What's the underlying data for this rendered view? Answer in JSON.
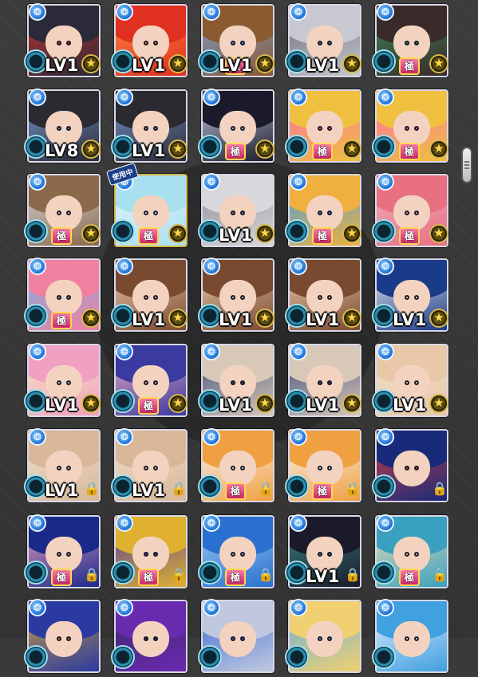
{
  "colors": {
    "element_water": "#1b6fd6",
    "frame_default": "#d8d8e8",
    "frame_gold": "#d9b24a",
    "star_gold": "#ffd84a"
  },
  "glyphs": {
    "star": "★",
    "lock": "🔒",
    "element": "❂"
  },
  "badges": {
    "goku": "極",
    "in_use": "使用中"
  },
  "rows": [
    [
      {
        "level": "LV1",
        "goku": false,
        "end": "star",
        "hair": "#2a2a38",
        "accent": "#c83030"
      },
      {
        "level": "LV1",
        "goku": false,
        "end": "star",
        "hair": "#e03020",
        "accent": "#ff8a40"
      },
      {
        "level": "LV1",
        "goku": true,
        "end": "star",
        "hair": "#8a5a30",
        "accent": "#7aa0d8"
      },
      {
        "level": "LV1",
        "goku": false,
        "end": "star",
        "hair": "#c8c8d0",
        "accent": "#6a6a7a"
      },
      {
        "level": "",
        "goku": true,
        "end": "star",
        "hair": "#3a2a2a",
        "accent": "#3a8a5a"
      }
    ],
    [
      {
        "level": "LV8",
        "goku": false,
        "end": "star",
        "hair": "#2a2a30",
        "accent": "#7a9ad8"
      },
      {
        "level": "LV1",
        "goku": false,
        "end": "star",
        "hair": "#2a2a30",
        "accent": "#7a9ad8"
      },
      {
        "level": "",
        "goku": true,
        "end": "star",
        "hair": "#1a1a2a",
        "accent": "#c8d0e8"
      },
      {
        "level": "",
        "goku": true,
        "end": "star",
        "hair": "#f0c040",
        "accent": "#ff6aa8"
      },
      {
        "level": "",
        "goku": true,
        "end": "star",
        "hair": "#f0c040",
        "accent": "#ff6aa8"
      }
    ],
    [
      {
        "level": "",
        "goku": true,
        "end": "star",
        "hair": "#8a6a4a",
        "accent": "#d8d8e0"
      },
      {
        "level": "",
        "goku": true,
        "end": "star",
        "hair": "#a8e0f0",
        "accent": "#e8f4ff",
        "gold": true,
        "in_use": true
      },
      {
        "level": "LV1",
        "goku": false,
        "end": "star",
        "hair": "#d8d8dc",
        "accent": "#8a8a90"
      },
      {
        "level": "",
        "goku": true,
        "end": "star",
        "hair": "#f0b040",
        "accent": "#40a0e0"
      },
      {
        "level": "",
        "goku": true,
        "end": "star",
        "hair": "#e87080",
        "accent": "#f0b0c0"
      }
    ],
    [
      {
        "level": "",
        "goku": true,
        "end": "star",
        "hair": "#f080a0",
        "accent": "#7ab0e8"
      },
      {
        "level": "LV1",
        "goku": false,
        "end": "star",
        "hair": "#7a4a30",
        "accent": "#f0d0b0"
      },
      {
        "level": "LV1",
        "goku": false,
        "end": "star",
        "hair": "#7a4a30",
        "accent": "#f0d0b0"
      },
      {
        "level": "LV1",
        "goku": false,
        "end": "star",
        "hair": "#7a4a30",
        "accent": "#f0d0b0"
      },
      {
        "level": "LV1",
        "goku": false,
        "end": "star",
        "hair": "#1a3a8a",
        "accent": "#f0f0f0"
      }
    ],
    [
      {
        "level": "LV1",
        "goku": false,
        "end": "star",
        "hair": "#f0a0c0",
        "accent": "#f8e8c0"
      },
      {
        "level": "",
        "goku": true,
        "end": "star",
        "hair": "#3a3aa0",
        "accent": "#f0b0c0"
      },
      {
        "level": "LV1",
        "goku": false,
        "end": "star",
        "hair": "#d8c8b8",
        "accent": "#3a4a7a"
      },
      {
        "level": "LV1",
        "goku": false,
        "end": "star",
        "hair": "#d8c8b8",
        "accent": "#3a4a7a"
      },
      {
        "level": "LV1",
        "goku": false,
        "end": "star",
        "hair": "#e8c8a8",
        "accent": "#f0e0d0"
      }
    ],
    [
      {
        "level": "LV1",
        "goku": false,
        "end": "lock",
        "hair": "#d8b898",
        "accent": "#f0e0d0"
      },
      {
        "level": "LV1",
        "goku": false,
        "end": "lock",
        "hair": "#d8b898",
        "accent": "#f0e0d0"
      },
      {
        "level": "",
        "goku": true,
        "end": "lock",
        "hair": "#f0a040",
        "accent": "#f8f8f8"
      },
      {
        "level": "",
        "goku": true,
        "end": "lock",
        "hair": "#f0a040",
        "accent": "#f8f8f8"
      },
      {
        "level": "",
        "goku": false,
        "end": "lock",
        "hair": "#1a2a7a",
        "accent": "#d04040"
      }
    ],
    [
      {
        "level": "",
        "goku": true,
        "end": "lock",
        "hair": "#1a2a8a",
        "accent": "#f0a0c0"
      },
      {
        "level": "",
        "goku": true,
        "end": "lock",
        "hair": "#e0b030",
        "accent": "#4a3aa0"
      },
      {
        "level": "",
        "goku": true,
        "end": "lock",
        "hair": "#2a70d0",
        "accent": "#a0d0f0"
      },
      {
        "level": "LV1",
        "goku": false,
        "end": "lock",
        "hair": "#1a1a2a",
        "accent": "#3a8a8a"
      },
      {
        "level": "",
        "goku": true,
        "end": "lock",
        "hair": "#3aa0c0",
        "accent": "#f0e0b0"
      }
    ],
    [
      {
        "level": "",
        "goku": false,
        "end": "",
        "hair": "#2a3aa0",
        "accent": "#d0a040"
      },
      {
        "level": "",
        "goku": false,
        "end": "",
        "hair": "#6a2ab0",
        "accent": "#3a2a6a"
      },
      {
        "level": "",
        "goku": false,
        "end": "",
        "hair": "#c0c8e0",
        "accent": "#3a6ad0"
      },
      {
        "level": "",
        "goku": false,
        "end": "",
        "hair": "#f0d070",
        "accent": "#60b0e0"
      },
      {
        "level": "",
        "goku": false,
        "end": "",
        "hair": "#40a0e0",
        "accent": "#e8f0ff"
      }
    ]
  ]
}
